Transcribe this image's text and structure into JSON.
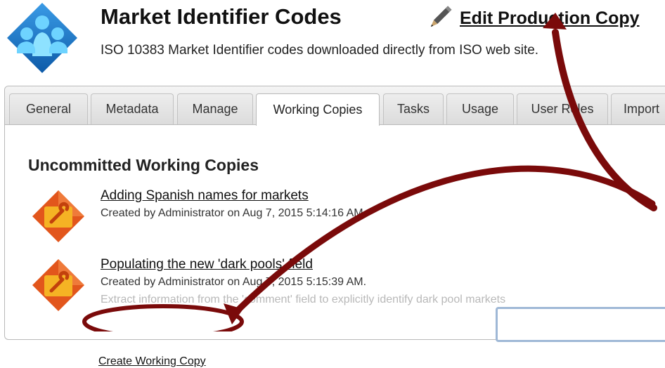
{
  "header": {
    "title": "Market Identifier Codes",
    "subtitle": "ISO 10383 Market Identifier codes downloaded directly from ISO web site.",
    "edit_label": "Edit Production Copy",
    "logo_icon": "people-diamond-icon",
    "edit_icon": "pencil-icon"
  },
  "tabs": [
    {
      "label": "General",
      "active": false
    },
    {
      "label": "Metadata",
      "active": false
    },
    {
      "label": "Manage",
      "active": false
    },
    {
      "label": "Working Copies",
      "active": true
    },
    {
      "label": "Tasks",
      "active": false
    },
    {
      "label": "Usage",
      "active": false
    },
    {
      "label": "User Roles",
      "active": false
    },
    {
      "label": "Import",
      "active": false
    }
  ],
  "section_title": "Uncommitted Working Copies",
  "working_copies": [
    {
      "name": "Adding Spanish names for markets",
      "meta": "Created by Administrator on Aug 7, 2015 5:14:16 AM.",
      "description": ""
    },
    {
      "name": "Populating the new 'dark pools' field",
      "meta": "Created by Administrator on Aug 7, 2015 5:15:39 AM.",
      "description": "Extract information from the 'comment' field to explicitly identify dark pool markets"
    }
  ],
  "create_label": "Create Working Copy",
  "colors": {
    "annotation": "#7a0a0a",
    "logo_blue": "#1a73c7",
    "wc_orange": "#e2561c",
    "wc_yellow": "#f5b324"
  }
}
